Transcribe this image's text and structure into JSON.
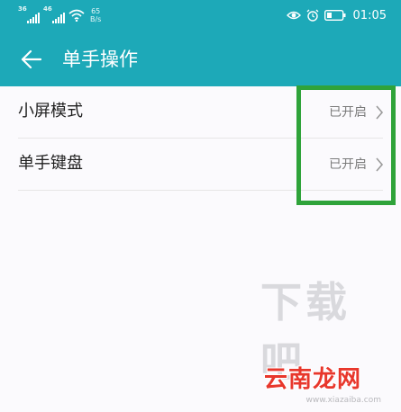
{
  "status_bar": {
    "signal_1": "36",
    "signal_2": "46",
    "net_speed_value": "65",
    "net_speed_unit": "B/s",
    "time": "01:05",
    "icons": [
      "signal-icon",
      "signal-icon",
      "wifi-icon",
      "eye-icon",
      "alarm-icon",
      "battery-icon"
    ]
  },
  "app_bar": {
    "title": "单手操作"
  },
  "settings": [
    {
      "label": "小屏模式",
      "value": "已开启"
    },
    {
      "label": "单手键盘",
      "value": "已开启"
    }
  ],
  "watermark": {
    "front": "云南龙网",
    "back": "下载吧",
    "url": "www.xiazaiba.com"
  },
  "colors": {
    "accent": "#1da9b8",
    "highlight": "#2fa33a",
    "watermark_red": "#e8372c"
  }
}
